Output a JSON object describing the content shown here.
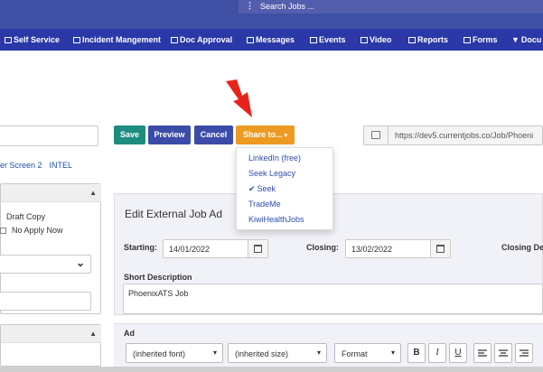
{
  "search": {
    "dots": "⋮",
    "text": "Search Jobs ..."
  },
  "nav": {
    "items": [
      {
        "label": "Self Service"
      },
      {
        "label": "Incident Mangement"
      },
      {
        "label": "Doc Approval"
      },
      {
        "label": "Messages"
      },
      {
        "label": "Events"
      },
      {
        "label": "Video"
      },
      {
        "label": "Reports"
      },
      {
        "label": "Forms"
      },
      {
        "label": "Docu"
      }
    ]
  },
  "toolbar": {
    "save": "Save",
    "preview": "Preview",
    "cancel": "Cancel",
    "share": "Share to...",
    "caret": "▾"
  },
  "url": "https://dev5.currentjobs.co/Job/Phoeni",
  "breadcrumbs": {
    "a": "er Screen 2",
    "b": "INTEL"
  },
  "left": {
    "chev1": "▲",
    "chev2": "▲",
    "draft": "Draft Copy",
    "noapply": "No Apply Now",
    "select_caret": "⌄"
  },
  "share_menu": {
    "items": [
      {
        "label": "LinkedIn (free)",
        "checked": false
      },
      {
        "label": "Seek Legacy",
        "checked": false
      },
      {
        "label": "Seek",
        "checked": true
      },
      {
        "label": "TradeMe",
        "checked": false
      },
      {
        "label": "KiwiHealthJobs",
        "checked": false
      }
    ],
    "tick": "✔"
  },
  "edit": {
    "title": "Edit External Job Ad",
    "starting_label": "Starting:",
    "starting_value": "14/01/2022",
    "closing_label": "Closing:",
    "closing_value": "13/02/2022",
    "closing_desc_label": "Closing Des",
    "short_desc_label": "Short Description",
    "short_desc_value": "PhoenixATS Job",
    "ad_label": "Ad"
  },
  "editor": {
    "font": "(inherited font)",
    "size": "(inherited size)",
    "format": "Format",
    "caret": "▾",
    "bold": "B",
    "italic": "I",
    "underline": "U"
  },
  "colors": {
    "topbar": "#3f4fa3",
    "navbar": "#2a38a8",
    "save": "#1e8c80",
    "primary": "#3b4ca8",
    "share": "#ed9a23",
    "arrow": "#e8231c"
  }
}
